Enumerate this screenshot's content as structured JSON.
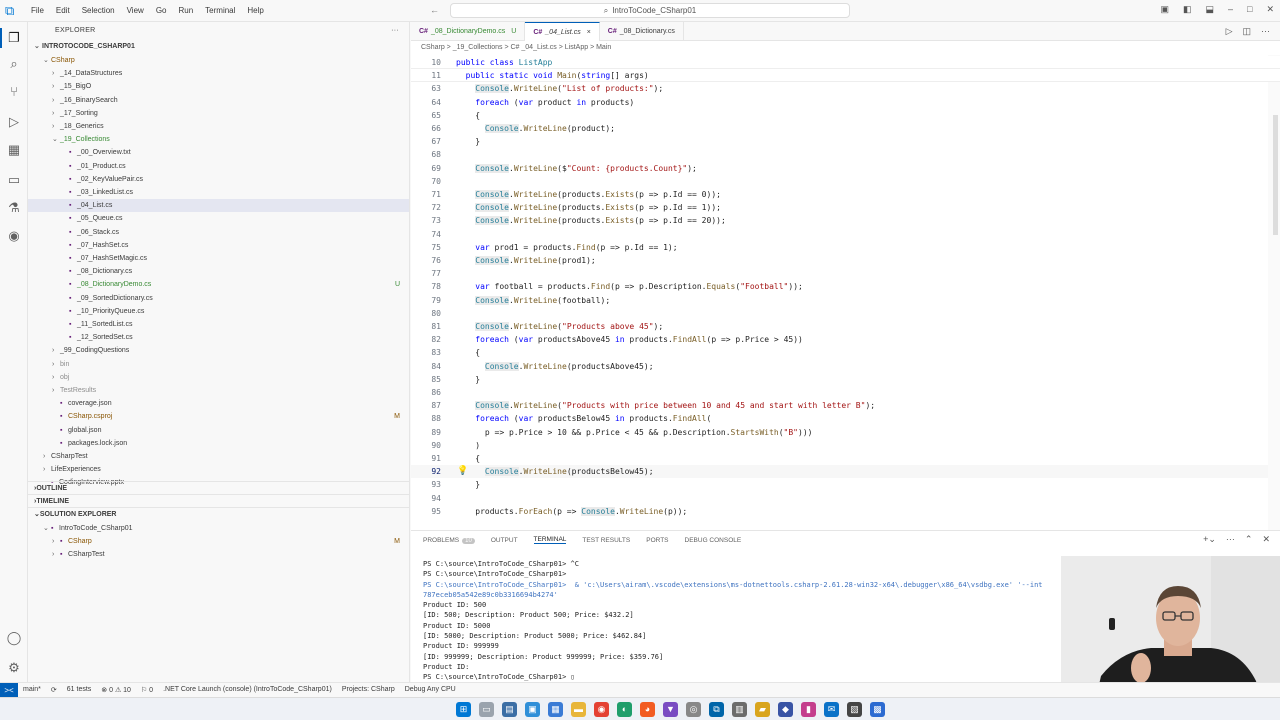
{
  "menu": [
    "File",
    "Edit",
    "Selection",
    "View",
    "Go",
    "Run",
    "Terminal",
    "Help"
  ],
  "search": {
    "text": "IntroToCode_CSharp01"
  },
  "explorer": {
    "header": "EXPLORER",
    "root": "INTROTOCODE_CSHARP01",
    "items": [
      {
        "label": "CSharp",
        "indent": 1,
        "chev": "v",
        "cls": "c-orange",
        "badge": ""
      },
      {
        "label": "_14_DataStructures",
        "indent": 2,
        "chev": ">",
        "cls": "",
        "badge": ""
      },
      {
        "label": "_15_BigO",
        "indent": 2,
        "chev": ">",
        "cls": "",
        "badge": ""
      },
      {
        "label": "_16_BinarySearch",
        "indent": 2,
        "chev": ">",
        "cls": "",
        "badge": ""
      },
      {
        "label": "_17_Sorting",
        "indent": 2,
        "chev": ">",
        "cls": "",
        "badge": ""
      },
      {
        "label": "_18_Generics",
        "indent": 2,
        "chev": ">",
        "cls": "",
        "badge": ""
      },
      {
        "label": "_19_Collections",
        "indent": 2,
        "chev": "v",
        "cls": "c-green",
        "badge": ""
      },
      {
        "label": "_00_Overview.txt",
        "indent": 3,
        "chev": "",
        "cls": "",
        "badge": ""
      },
      {
        "label": "_01_Product.cs",
        "indent": 3,
        "chev": "",
        "cls": "",
        "badge": ""
      },
      {
        "label": "_02_KeyValuePair.cs",
        "indent": 3,
        "chev": "",
        "cls": "",
        "badge": ""
      },
      {
        "label": "_03_LinkedList.cs",
        "indent": 3,
        "chev": "",
        "cls": "",
        "badge": ""
      },
      {
        "label": "_04_List.cs",
        "indent": 3,
        "chev": "",
        "cls": "",
        "badge": "",
        "selected": true
      },
      {
        "label": "_05_Queue.cs",
        "indent": 3,
        "chev": "",
        "cls": "",
        "badge": ""
      },
      {
        "label": "_06_Stack.cs",
        "indent": 3,
        "chev": "",
        "cls": "",
        "badge": ""
      },
      {
        "label": "_07_HashSet.cs",
        "indent": 3,
        "chev": "",
        "cls": "",
        "badge": ""
      },
      {
        "label": "_07_HashSetMagic.cs",
        "indent": 3,
        "chev": "",
        "cls": "",
        "badge": ""
      },
      {
        "label": "_08_Dictionary.cs",
        "indent": 3,
        "chev": "",
        "cls": "",
        "badge": ""
      },
      {
        "label": "_08_DictionaryDemo.cs",
        "indent": 3,
        "chev": "",
        "cls": "c-green",
        "badge": "U"
      },
      {
        "label": "_09_SortedDictionary.cs",
        "indent": 3,
        "chev": "",
        "cls": "",
        "badge": ""
      },
      {
        "label": "_10_PriorityQueue.cs",
        "indent": 3,
        "chev": "",
        "cls": "",
        "badge": ""
      },
      {
        "label": "_11_SortedList.cs",
        "indent": 3,
        "chev": "",
        "cls": "",
        "badge": ""
      },
      {
        "label": "_12_SortedSet.cs",
        "indent": 3,
        "chev": "",
        "cls": "",
        "badge": ""
      },
      {
        "label": "_99_CodingQuestions",
        "indent": 2,
        "chev": ">",
        "cls": "",
        "badge": ""
      },
      {
        "label": "bin",
        "indent": 2,
        "chev": ">",
        "cls": "c-grey",
        "badge": ""
      },
      {
        "label": "obj",
        "indent": 2,
        "chev": ">",
        "cls": "c-grey",
        "badge": ""
      },
      {
        "label": "TestResults",
        "indent": 2,
        "chev": ">",
        "cls": "c-grey",
        "badge": ""
      },
      {
        "label": "coverage.json",
        "indent": 2,
        "chev": "",
        "cls": "",
        "badge": ""
      },
      {
        "label": "CSharp.csproj",
        "indent": 2,
        "chev": "",
        "cls": "c-orange",
        "badge": "M"
      },
      {
        "label": "global.json",
        "indent": 2,
        "chev": "",
        "cls": "",
        "badge": ""
      },
      {
        "label": "packages.lock.json",
        "indent": 2,
        "chev": "",
        "cls": "",
        "badge": ""
      },
      {
        "label": "CSharpTest",
        "indent": 1,
        "chev": ">",
        "cls": "",
        "badge": ""
      },
      {
        "label": "LifeExperiences",
        "indent": 1,
        "chev": ">",
        "cls": "",
        "badge": ""
      },
      {
        "label": "CodingInterview.pptx",
        "indent": 1,
        "chev": "",
        "cls": "",
        "badge": ""
      }
    ],
    "sections": [
      "OUTLINE",
      "TIMELINE",
      "SOLUTION EXPLORER"
    ],
    "solution": [
      {
        "label": "IntroToCode_CSharp01",
        "indent": 1,
        "badge": ""
      },
      {
        "label": "CSharp",
        "indent": 2,
        "badge": "M",
        "cls": "c-orange"
      },
      {
        "label": "CSharpTest",
        "indent": 2,
        "badge": ""
      }
    ]
  },
  "tabs": [
    {
      "label": "_08_DictionaryDemo.cs",
      "suffix": "U",
      "active": false,
      "cls": "c-green"
    },
    {
      "label": "_04_List.cs",
      "suffix": "×",
      "active": true,
      "cls": ""
    },
    {
      "label": "_08_Dictionary.cs",
      "suffix": "",
      "active": false,
      "cls": ""
    }
  ],
  "breadcrumb": "CSharp > _19_Collections > C# _04_List.cs > ListApp > Main",
  "code": [
    {
      "n": "10",
      "t": "public class ListApp",
      "sticky": true
    },
    {
      "n": "11",
      "t": "  public static void Main(string[] args)",
      "sticky": true
    },
    {
      "n": "63",
      "t": "    Console.WriteLine(\"List of products:\");"
    },
    {
      "n": "64",
      "t": "    foreach (var product in products)"
    },
    {
      "n": "65",
      "t": "    {"
    },
    {
      "n": "66",
      "t": "      Console.WriteLine(product);"
    },
    {
      "n": "67",
      "t": "    }"
    },
    {
      "n": "68",
      "t": ""
    },
    {
      "n": "69",
      "t": "    Console.WriteLine($\"Count: {products.Count}\");"
    },
    {
      "n": "70",
      "t": ""
    },
    {
      "n": "71",
      "t": "    Console.WriteLine(products.Exists(p => p.Id == 0));"
    },
    {
      "n": "72",
      "t": "    Console.WriteLine(products.Exists(p => p.Id == 1));"
    },
    {
      "n": "73",
      "t": "    Console.WriteLine(products.Exists(p => p.Id == 20));"
    },
    {
      "n": "74",
      "t": ""
    },
    {
      "n": "75",
      "t": "    var prod1 = products.Find(p => p.Id == 1);"
    },
    {
      "n": "76",
      "t": "    Console.WriteLine(prod1);"
    },
    {
      "n": "77",
      "t": ""
    },
    {
      "n": "78",
      "t": "    var football = products.Find(p => p.Description.Equals(\"Football\"));"
    },
    {
      "n": "79",
      "t": "    Console.WriteLine(football);"
    },
    {
      "n": "80",
      "t": ""
    },
    {
      "n": "81",
      "t": "    Console.WriteLine(\"Products above 45\");"
    },
    {
      "n": "82",
      "t": "    foreach (var productsAbove45 in products.FindAll(p => p.Price > 45))"
    },
    {
      "n": "83",
      "t": "    {"
    },
    {
      "n": "84",
      "t": "      Console.WriteLine(productsAbove45);"
    },
    {
      "n": "85",
      "t": "    }"
    },
    {
      "n": "86",
      "t": ""
    },
    {
      "n": "87",
      "t": "    Console.WriteLine(\"Products with price between 10 and 45 and start with letter B\");"
    },
    {
      "n": "88",
      "t": "    foreach (var productsBelow45 in products.FindAll("
    },
    {
      "n": "89",
      "t": "      p => p.Price > 10 && p.Price < 45 && p.Description.StartsWith(\"B\")))"
    },
    {
      "n": "90",
      "t": "    )"
    },
    {
      "n": "91",
      "t": "    {"
    },
    {
      "n": "92",
      "t": "      Console.WriteLine(productsBelow45);",
      "current": true
    },
    {
      "n": "93",
      "t": "    }"
    },
    {
      "n": "94",
      "t": ""
    },
    {
      "n": "95",
      "t": "    products.ForEach(p => Console.WriteLine(p));"
    }
  ],
  "panel": {
    "tabs": [
      {
        "label": "PROBLEMS",
        "count": "10"
      },
      {
        "label": "OUTPUT",
        "count": ""
      },
      {
        "label": "TERMINAL",
        "count": "",
        "active": true
      },
      {
        "label": "TEST RESULTS",
        "count": ""
      },
      {
        "label": "PORTS",
        "count": ""
      },
      {
        "label": "DEBUG CONSOLE",
        "count": ""
      }
    ],
    "terminal": [
      {
        "t": "PS C:\\source\\IntroToCode_CSharp01> ^C"
      },
      {
        "t": "PS C:\\source\\IntroToCode_CSharp01>"
      },
      {
        "t": "PS C:\\source\\IntroToCode_CSharp01>  & 'c:\\Users\\airam\\.vscode\\extensions\\ms-dotnettools.csharp-2.61.28-win32-x64\\.debugger\\x86_64\\vsdbg.exe' '--int",
        "path": true
      },
      {
        "t": "787eceb05a542e89c0b3316694b4274'",
        "path": true
      },
      {
        "t": "Product ID: 500"
      },
      {
        "t": "[ID: 500; Description: Product 500; Price: $432.2]"
      },
      {
        "t": "Product ID: 5000"
      },
      {
        "t": "[ID: 5000; Description: Product 5000; Price: $462.84]"
      },
      {
        "t": "Product ID: 999999"
      },
      {
        "t": "[ID: 999999; Description: Product 999999; Price: $359.76]"
      },
      {
        "t": "Product ID:"
      },
      {
        "t": "PS C:\\source\\IntroToCode_CSharp01> ▯"
      }
    ]
  },
  "status": {
    "remote": "><",
    "items": [
      "main*",
      "⟳",
      "61 tests",
      "⊗ 0  ⚠ 10",
      "⚐ 0",
      ".NET Core Launch (console) (IntroToCode_CSharp01)",
      "Projects: CSharp",
      "Debug Any CPU"
    ]
  },
  "colors": {
    "accent": "#005fb8",
    "keyword": "#0000ff",
    "type": "#267f99",
    "string": "#a31515",
    "method": "#795e26"
  }
}
